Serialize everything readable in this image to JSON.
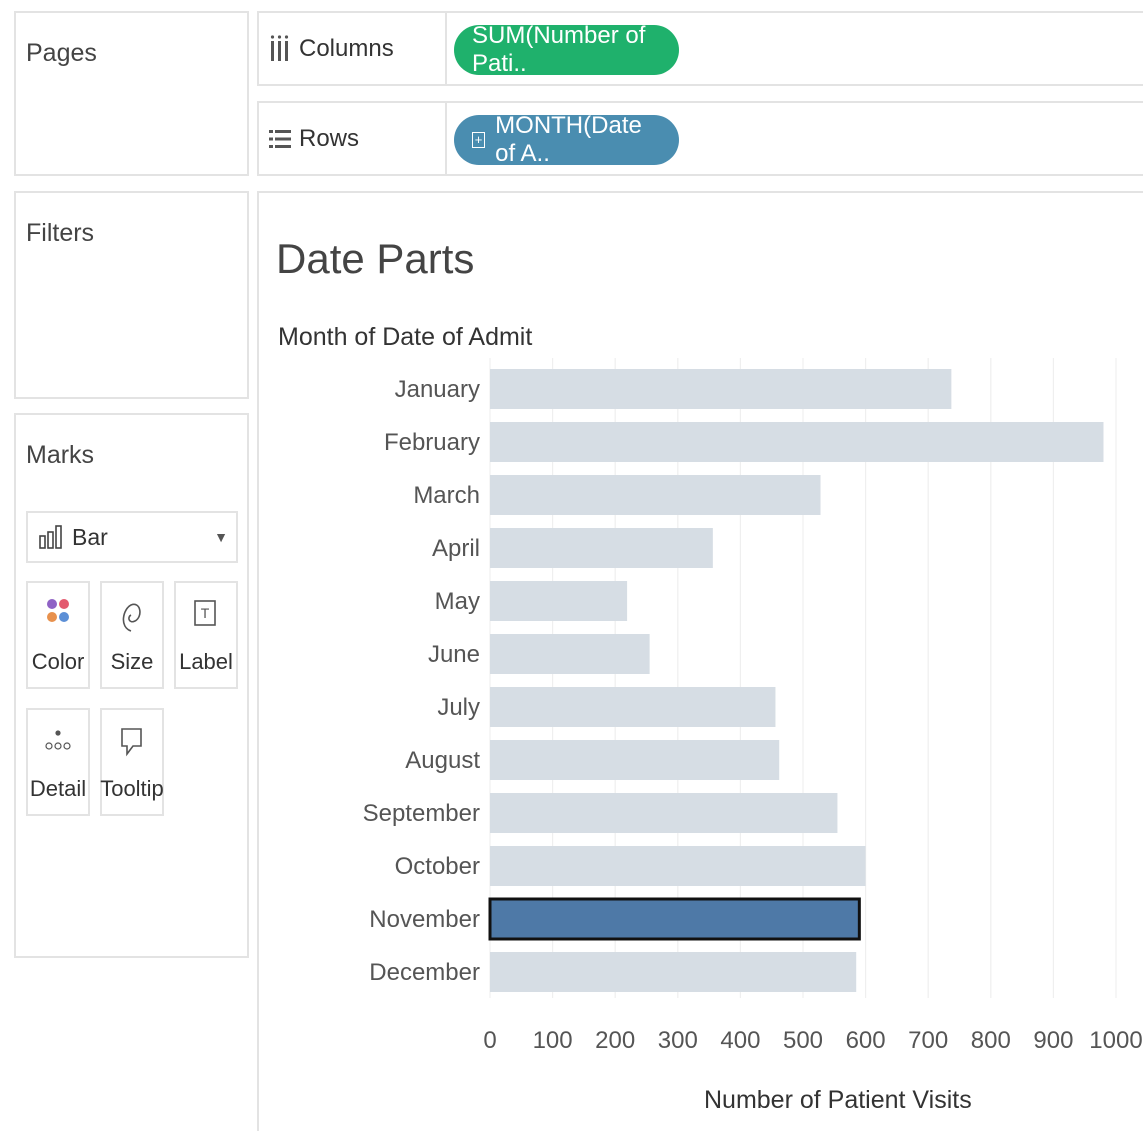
{
  "panels": {
    "pages_title": "Pages",
    "filters_title": "Filters",
    "marks_title": "Marks"
  },
  "shelves": {
    "columns_label": "Columns",
    "columns_pill": "SUM(Number of Pati..",
    "rows_label": "Rows",
    "rows_pill": "MONTH(Date of A.."
  },
  "marks": {
    "type": "Bar",
    "buttons": [
      "Color",
      "Size",
      "Label",
      "Detail",
      "Tooltip"
    ]
  },
  "view": {
    "title": "Date Parts",
    "row_header": "Month of Date of Admit"
  },
  "colors": {
    "bar": "#d6dde4",
    "bar_selected": "#4e79a7",
    "columns_pill": "#1fb16c",
    "rows_pill": "#4a8db0"
  },
  "chart_data": {
    "type": "bar",
    "orientation": "horizontal",
    "categories": [
      "January",
      "February",
      "March",
      "April",
      "May",
      "June",
      "July",
      "August",
      "September",
      "October",
      "November",
      "December"
    ],
    "values": [
      737,
      980,
      528,
      356,
      219,
      255,
      456,
      462,
      555,
      600,
      590,
      585
    ],
    "selected_category": "November",
    "xlabel": "Number of Patient Visits",
    "ylabel": "Month of Date of Admit",
    "xlim": [
      0,
      1050
    ],
    "xticks": [
      0,
      100,
      200,
      300,
      400,
      500,
      600,
      700,
      800,
      900,
      1000
    ],
    "grid": true
  }
}
